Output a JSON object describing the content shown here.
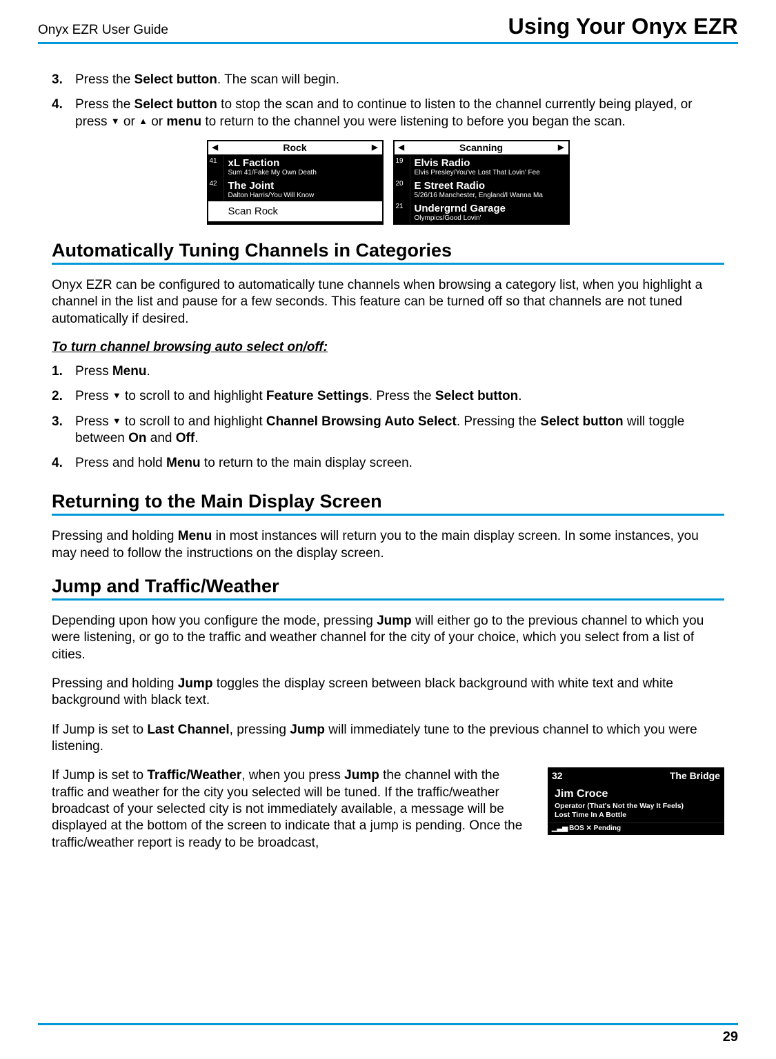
{
  "header": {
    "left": "Onyx EZR User Guide",
    "right": "Using Your Onyx EZR"
  },
  "section1": {
    "step3_a": "Press the ",
    "step3_b": "Select button",
    "step3_c": ". The scan will begin.",
    "step4_a": "Press the ",
    "step4_b": "Select button",
    "step4_c": " to stop the scan and to continue to listen to the channel currently being played, or press ",
    "step4_d": " or ",
    "step4_e": " or ",
    "step4_f": "menu",
    "step4_g": " to return to the channel you were listening to before you began the scan."
  },
  "screen_left": {
    "title": "Rock",
    "rows": [
      {
        "num": "41",
        "title": "xL Faction",
        "sub": "Sum 41/Fake My Own Death"
      },
      {
        "num": "42",
        "title": "The Joint",
        "sub": "Dalton Harris/You Will Know"
      }
    ],
    "scan": "Scan Rock"
  },
  "screen_right": {
    "title": "Scanning",
    "rows": [
      {
        "num": "19",
        "title": "Elvis Radio",
        "sub": "Elvis Presley/You've Lost That Lovin' Fee"
      },
      {
        "num": "20",
        "title": "E Street Radio",
        "sub": "5/26/16 Manchester, England/I Wanna Ma"
      },
      {
        "num": "21",
        "title": "Undergrnd Garage",
        "sub": "Olympics/Good Lovin'"
      }
    ]
  },
  "auto": {
    "heading": "Automatically Tuning Channels in Categories",
    "para": "Onyx EZR can be configured to automatically tune channels when browsing a category list, when you highlight a channel in the list and pause for a few seconds. This feature can be turned off so that channels are not tuned automatically if desired.",
    "subhead": "To turn channel browsing auto select on/off:",
    "s1_a": "Press ",
    "s1_b": "Menu",
    "s1_c": ".",
    "s2_a": "Press ",
    "s2_b": " to scroll to and highlight ",
    "s2_c": "Feature Settings",
    "s2_d": ". Press the ",
    "s2_e": "Select button",
    "s2_f": ".",
    "s3_a": "Press ",
    "s3_b": " to scroll to and highlight ",
    "s3_c": "Channel Browsing Auto Select",
    "s3_d": ". Pressing the ",
    "s3_e": "Select button",
    "s3_f": " will toggle between ",
    "s3_g": "On",
    "s3_h": " and ",
    "s3_i": "Off",
    "s3_j": ".",
    "s4_a": "Press and hold ",
    "s4_b": "Menu",
    "s4_c": " to return to the main display screen."
  },
  "returning": {
    "heading": "Returning to the Main Display Screen",
    "para_a": "Pressing and holding ",
    "para_b": "Menu",
    "para_c": " in most instances will return you to the main display screen. In some instances, you may need to follow the instructions on the display screen."
  },
  "jump": {
    "heading": "Jump and Traffic/Weather",
    "p1_a": "Depending upon how you configure the mode, pressing ",
    "p1_b": "Jump",
    "p1_c": " will either go to the previous channel to which you were listening, or go to the traffic and weather channel for the city of your choice, which you select from a list of cities.",
    "p2_a": "Pressing and holding ",
    "p2_b": "Jump",
    "p2_c": " toggles the display screen between black background with white text and white background with black text.",
    "p3_a": "If Jump is set to ",
    "p3_b": "Last Channel",
    "p3_c": ", pressing ",
    "p3_d": "Jump",
    "p3_e": " will immediately tune to the previous channel to which you were listening.",
    "p4_a": "If Jump is set to ",
    "p4_b": "Traffic/Weather",
    "p4_c": ", when you press ",
    "p4_d": "Jump",
    "p4_e": " the channel with the traffic and weather for the city you selected will be tuned. If the traffic/weather broadcast of your selected city is not immediately available, a message will be displayed at the bottom of the screen to indicate that a jump is pending. Once the traffic/weather report is ready to be broadcast,"
  },
  "jump_screen": {
    "ch": "32",
    "name": "The Bridge",
    "artist": "Jim Croce",
    "line1": "Operator (That's Not the Way It Feels)",
    "line2": "Lost Time In A Bottle",
    "footer": "BOS ✕ Pending"
  },
  "page_num": "29"
}
